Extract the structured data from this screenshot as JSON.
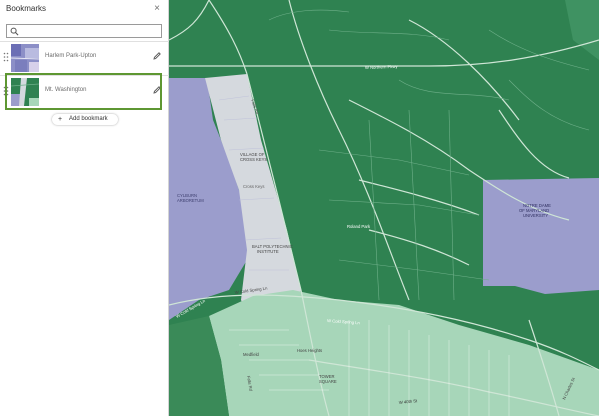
{
  "panel": {
    "title": "Bookmarks",
    "close_label": "×",
    "search": {
      "placeholder": "",
      "value": ""
    },
    "bookmarks": [
      {
        "label": "Harlem Park-Upton",
        "selected": false
      },
      {
        "label": "Mt. Washington",
        "selected": true
      }
    ],
    "add_button": {
      "label": "Add bookmark",
      "icon": "plus-icon"
    },
    "icons": {
      "search": "search-icon",
      "edit": "pencil-icon",
      "drag": "drag-handle-icon",
      "close": "close-icon"
    },
    "selection_color": "#5e9732"
  },
  "map": {
    "colors": {
      "dark_green": "#2f8251",
      "light_green": "#a7d6b9",
      "lavender": "#9b9dcc",
      "gray": "#d5d9de",
      "road": "#cfe6d6"
    },
    "labels": {
      "w_northern_pkwy": "W Northern Pkwy",
      "falls_rd": "Falls Rd",
      "village_cross_keys_1": "VILLAGE OF",
      "village_cross_keys_2": "CROSS KEYS",
      "cross_keys": "Cross Keys",
      "cylburn_1": "CYLBURN",
      "cylburn_2": "ARBORETUM",
      "poly_1": "BALT POLYTECHNIC",
      "poly_2": "INSTITUTE",
      "w_cold_spring_1": "W Cold Spring Ln",
      "w_cold_spring_2": "W Cold Spring Ln",
      "w_cold_spring_3": "W Cold Spring Ln",
      "medfield": "Medfield",
      "hoes_heights": "Hoes Heights",
      "tower_square_1": "TOWER",
      "tower_square_2": "SQUARE",
      "w_40th": "W 40th St",
      "notre_dame_1": "NOTRE DAME",
      "notre_dame_2": "OF MARYLAND",
      "notre_dame_3": "UNIVERSITY",
      "falls_rd_bottom": "Falls Rd",
      "n_charles": "N Charles St",
      "roland_park": "Roland Park"
    }
  }
}
